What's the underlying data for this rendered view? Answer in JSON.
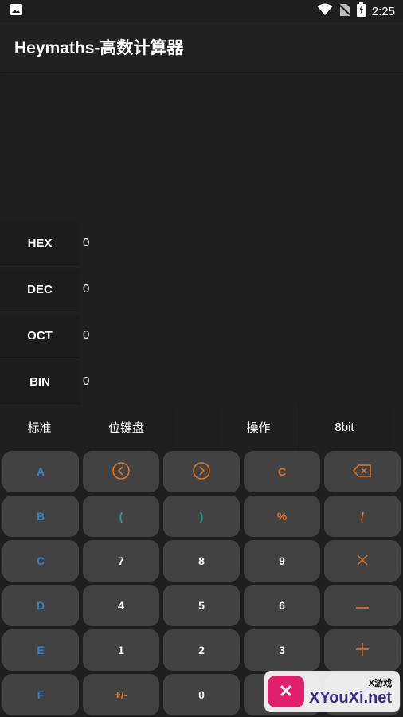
{
  "status_bar": {
    "time": "2:25",
    "icons": [
      "image-icon",
      "wifi-icon",
      "no-sim-icon",
      "battery-charging-icon"
    ]
  },
  "app": {
    "title": "Heymaths-高数计算器"
  },
  "bases": [
    {
      "label": "HEX",
      "value": "0"
    },
    {
      "label": "DEC",
      "value": "0"
    },
    {
      "label": "OCT",
      "value": "0"
    },
    {
      "label": "BIN",
      "value": "0"
    }
  ],
  "tabs": [
    "标准",
    "位键盘",
    "",
    "操作",
    "8bit"
  ],
  "keys": {
    "row1": [
      "A",
      "left-arrow-icon",
      "right-arrow-icon",
      "C",
      "backspace-icon"
    ],
    "row2": [
      "B",
      "(",
      ")",
      "%",
      "/"
    ],
    "row3": [
      "C",
      "7",
      "8",
      "9",
      "multiply-icon"
    ],
    "row4": [
      "D",
      "4",
      "5",
      "6",
      "minus-icon"
    ],
    "row5": [
      "E",
      "1",
      "2",
      "3",
      "plus-icon"
    ],
    "row6": [
      "F",
      "+/-",
      "0",
      "",
      ""
    ]
  },
  "colors": {
    "hex_letter": "#3b82c7",
    "paren": "#1fa59a",
    "operator": "#e0782c",
    "key_bg": "#424242",
    "background": "#1f1f1f"
  },
  "watermark": {
    "small": "X游戏",
    "big": "XYouXi.net"
  }
}
